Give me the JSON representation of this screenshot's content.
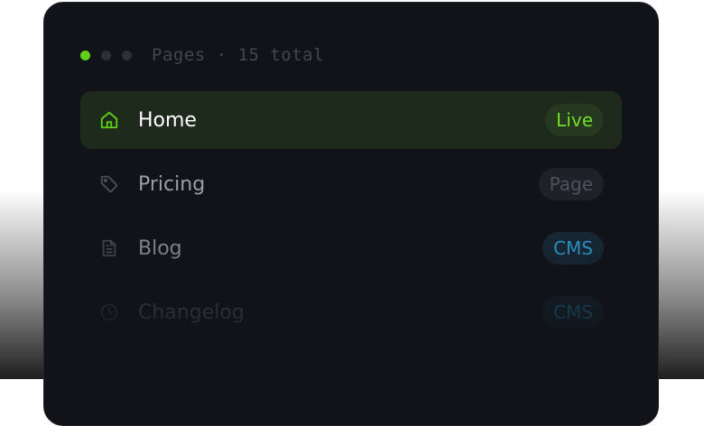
{
  "header": {
    "text": "Pages · 15 total"
  },
  "pages": [
    {
      "label": "Home",
      "icon": "home-icon",
      "badge": "Live",
      "active": true,
      "label_color": "#ffffff",
      "icon_color": "#5fd11b",
      "badge_text_color": "#6fde28",
      "badge_bg": "#26381f"
    },
    {
      "label": "Pricing",
      "icon": "tag-icon",
      "badge": "Page",
      "active": false,
      "label_color": "#9a9ea7",
      "icon_color": "#4a4e57",
      "badge_text_color": "#4e525c",
      "badge_bg": "#1e2128"
    },
    {
      "label": "Blog",
      "icon": "document-icon",
      "badge": "CMS",
      "active": false,
      "label_color": "#7f838c",
      "icon_color": "#3f434b",
      "badge_text_color": "#2c8fbf",
      "badge_bg": "#162632"
    },
    {
      "label": "Changelog",
      "icon": "clock-icon",
      "badge": "CMS",
      "active": false,
      "label_color": "#464a52",
      "icon_color": "#30343b",
      "badge_text_color": "#1f5e7e",
      "badge_bg": "#14202a"
    }
  ],
  "colors": {
    "accent_green": "#5fd11b",
    "panel_bg": "#111318"
  }
}
